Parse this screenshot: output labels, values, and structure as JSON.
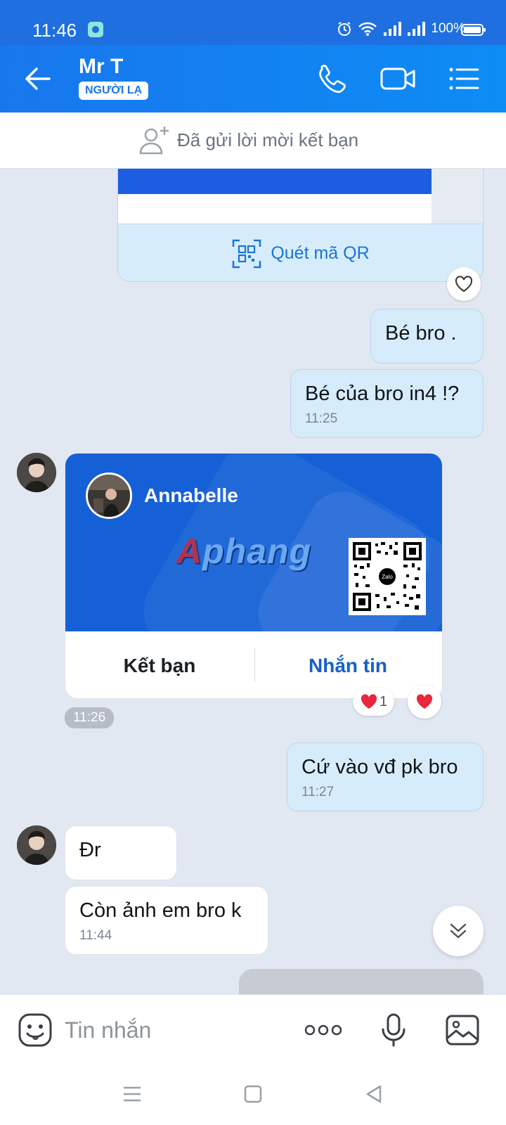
{
  "status_bar": {
    "time": "11:46",
    "battery": "100%"
  },
  "header": {
    "contact_name": "Mr T",
    "badge": "NGƯỜI LẠ",
    "icons": [
      "back-arrow-icon",
      "phone-icon",
      "video-call-icon",
      "menu-list-icon"
    ]
  },
  "friend_request": {
    "text": "Đã gửi lời mời kết bạn"
  },
  "messages": {
    "qr_card": {
      "scan_label": "Quét mã QR"
    },
    "out_1": {
      "text": "Bé bro ."
    },
    "out_2": {
      "text": "Bé của bro in4 !?",
      "time": "11:25"
    },
    "contact_card": {
      "name": "Annabelle",
      "watermark": "Aphang",
      "qr_logo": "Zalo",
      "add_friend": "Kết bạn",
      "send_message": "Nhắn tin",
      "reaction_count": "1",
      "time": "11:26"
    },
    "out_3": {
      "text": "Cứ vào vđ pk bro",
      "time": "11:27"
    },
    "in_1": {
      "text": "Đr"
    },
    "in_2": {
      "text": "Còn ảnh em bro k",
      "time": "11:44"
    }
  },
  "input_bar": {
    "placeholder": "Tin nhắn"
  },
  "colors": {
    "header_blue": "#1877ee",
    "card_blue": "#1560d6",
    "out_bubble": "#d7ecfb",
    "chat_bg": "#e2e8f1",
    "heart_red": "#e8283b"
  }
}
